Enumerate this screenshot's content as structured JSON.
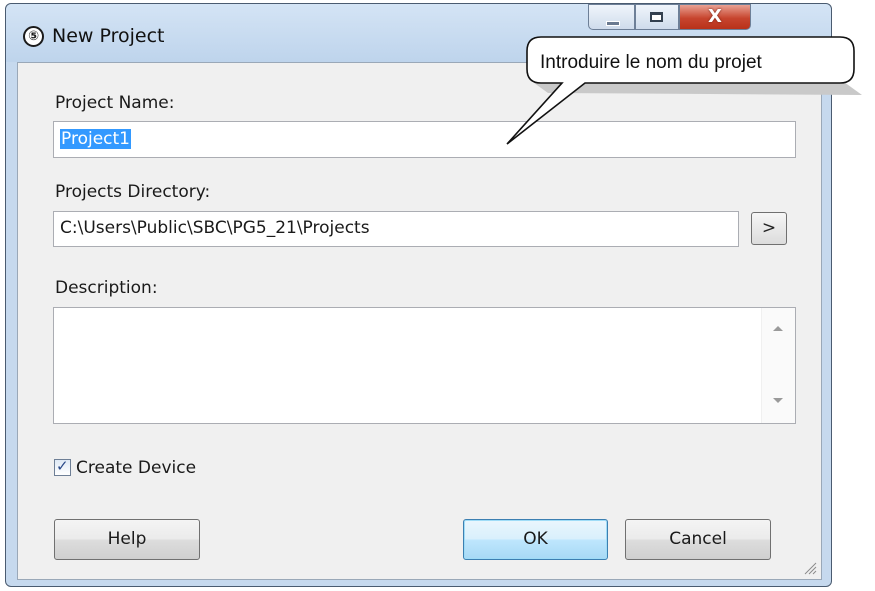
{
  "window": {
    "title": "New Project",
    "app_icon_glyph": "⑤",
    "caption_glyphs": {
      "minimize": "",
      "maximize": "",
      "close": "X"
    }
  },
  "form": {
    "project_name_label": "Project Name:",
    "project_name_value": "Project1",
    "projects_directory_label": "Projects Directory:",
    "projects_directory_value": "C:\\Users\\Public\\SBC\\PG5_21\\Projects",
    "browse_label": ">",
    "description_label": "Description:",
    "description_value": "",
    "create_device_label": "Create Device",
    "create_device_checked": true
  },
  "buttons": {
    "help": "Help",
    "ok": "OK",
    "cancel": "Cancel"
  },
  "callout": {
    "text": "Introduire le nom du projet"
  },
  "icons": [
    "app-logo-icon",
    "minimize-icon",
    "maximize-icon",
    "close-icon",
    "chevron-right-icon",
    "scroll-up-icon",
    "scroll-down-icon",
    "checkmark-icon",
    "resize-grip-icon"
  ],
  "colors": {
    "title_bar": "#bed4ec",
    "close_button": "#c7452e",
    "selection": "#3399ff",
    "dialog_bg": "#f0f0f0"
  }
}
